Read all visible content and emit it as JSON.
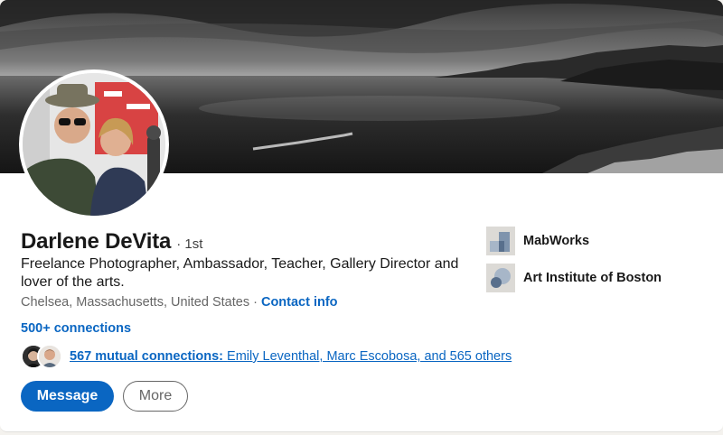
{
  "profile": {
    "name": "Darlene DeVita",
    "degree": "· 1st",
    "headline": "Freelance Photographer, Ambassador, Teacher, Gallery Director and lover of the arts.",
    "location": "Chelsea, Massachusetts, United States",
    "location_separator": " · ",
    "contact_info_label": "Contact info",
    "connections_label": "500+ connections",
    "mutual_count_label": "567 mutual connections:",
    "mutual_names": "Emily Leventhal, Marc Escobosa, and 565 others"
  },
  "actions": {
    "message_label": "Message",
    "more_label": "More"
  },
  "organizations": [
    {
      "name": "MabWorks",
      "icon": "company-logo-icon"
    },
    {
      "name": "Art Institute of Boston",
      "icon": "school-logo-icon"
    }
  ],
  "colors": {
    "link": "#0a66c2",
    "primary_button": "#0a66c2"
  }
}
